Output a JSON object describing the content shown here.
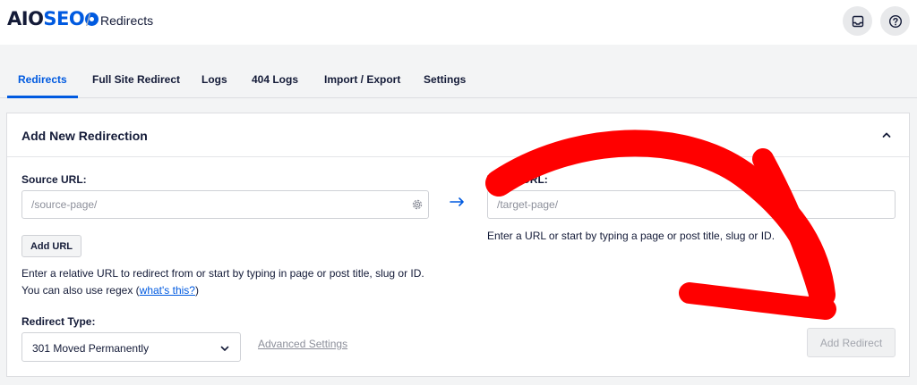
{
  "header": {
    "logo_prefix": "AIO",
    "logo_seo": "SEO",
    "separator": "/",
    "title": "Redirects"
  },
  "tabs": [
    {
      "label": "Redirects",
      "active": true
    },
    {
      "label": "Full Site Redirect",
      "active": false
    },
    {
      "label": "Logs",
      "active": false
    },
    {
      "label": "404 Logs",
      "active": false
    },
    {
      "label": "Import / Export",
      "active": false
    },
    {
      "label": "Settings",
      "active": false
    }
  ],
  "card": {
    "title": "Add New Redirection",
    "source": {
      "label": "Source URL:",
      "placeholder": "/source-page/",
      "add_url_label": "Add URL",
      "help_line1": "Enter a relative URL to redirect from or start by typing in page or post title, slug or ID.",
      "help_line2_prefix": "You can also use regex (",
      "help_link": "what's this?",
      "help_line2_suffix": ")"
    },
    "target": {
      "label": "Target URL:",
      "placeholder": "/target-page/",
      "help": "Enter a URL or start by typing a page or post title, slug or ID."
    },
    "redirect_type": {
      "label": "Redirect Type:",
      "selected": "301 Moved Permanently"
    },
    "advanced_settings_label": "Advanced Settings",
    "add_redirect_label": "Add Redirect"
  },
  "icons": {
    "inbox": "inbox-icon",
    "help": "help-circle-icon",
    "collapse": "chevron-up-icon",
    "source_settings": "gear-icon",
    "direction": "arrow-right-icon",
    "select_chevron": "chevron-down-icon",
    "annotation": "annotation-arrow-icon"
  },
  "colors": {
    "accent": "#005ae0",
    "annotation": "#ff0000",
    "text": "#141b38",
    "muted": "#8c8f9a"
  }
}
